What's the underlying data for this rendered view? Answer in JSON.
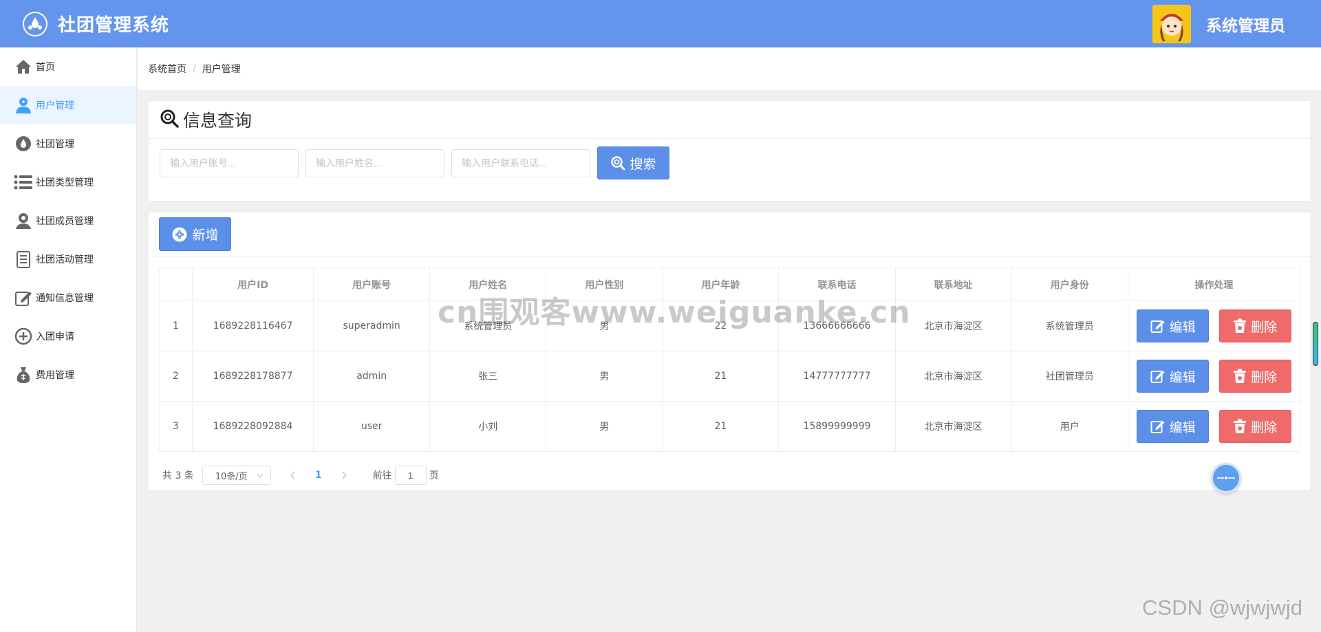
{
  "header": {
    "app_title": "社团管理系统",
    "user_name": "系统管理员"
  },
  "sidebar": {
    "items": [
      {
        "label": "首页",
        "icon": "home-icon",
        "active": false
      },
      {
        "label": "用户管理",
        "icon": "user-icon",
        "active": true
      },
      {
        "label": "社团管理",
        "icon": "drop-icon",
        "active": false
      },
      {
        "label": "社团类型管理",
        "icon": "list-icon",
        "active": false
      },
      {
        "label": "社团成员管理",
        "icon": "member-icon",
        "active": false
      },
      {
        "label": "社团活动管理",
        "icon": "document-icon",
        "active": false
      },
      {
        "label": "通知信息管理",
        "icon": "edit-icon",
        "active": false
      },
      {
        "label": "入团申请",
        "icon": "plus-circle-icon",
        "active": false
      },
      {
        "label": "费用管理",
        "icon": "money-bag-icon",
        "active": false
      }
    ]
  },
  "breadcrumb": {
    "home": "系统首页",
    "separator": "/",
    "current": "用户管理"
  },
  "search": {
    "title": "信息查询",
    "account_placeholder": "输入用户账号...",
    "name_placeholder": "输入用户姓名...",
    "phone_placeholder": "输入用户联系电话...",
    "search_label": "搜索"
  },
  "toolbar": {
    "add_label": "新增"
  },
  "table": {
    "columns": [
      "",
      "用户ID",
      "用户账号",
      "用户姓名",
      "用户性别",
      "用户年龄",
      "联系电话",
      "联系地址",
      "用户身份",
      "操作处理"
    ],
    "rows": [
      [
        "1",
        "1689228116467",
        "superadmin",
        "系统管理员",
        "男",
        "22",
        "13666666666",
        "北京市海淀区",
        "系统管理员"
      ],
      [
        "2",
        "1689228178877",
        "admin",
        "张三",
        "男",
        "21",
        "14777777777",
        "北京市海淀区",
        "社团管理员"
      ],
      [
        "3",
        "1689228092884",
        "user",
        "小刘",
        "男",
        "21",
        "15899999999",
        "北京市海淀区",
        "用户"
      ]
    ],
    "edit_label": "编辑",
    "delete_label": "删除"
  },
  "pagination": {
    "total": "共 3 条",
    "page_size": "10条/页",
    "current_page": "1",
    "goto_prefix": "前往",
    "goto_value": "1",
    "goto_suffix": "页"
  },
  "watermarks": {
    "center": "cn围观客www.weiguanke.cn",
    "corner": "CSDN @wjwjwjd"
  },
  "colors": {
    "header_bg": "#6495ed",
    "primary_button": "#5b8fe8",
    "danger_button": "#ef6b6b",
    "active_nav": "#409eff"
  }
}
